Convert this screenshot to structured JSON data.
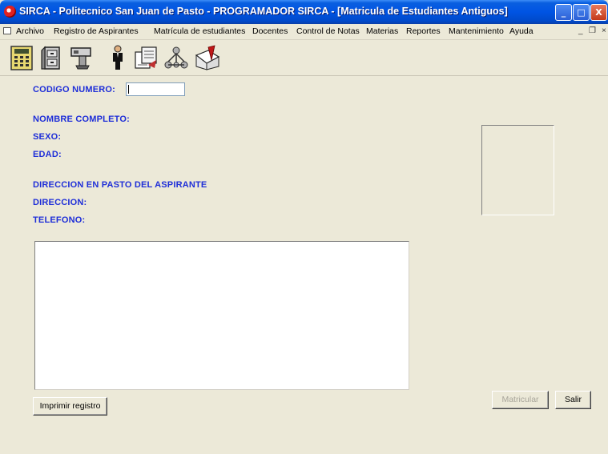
{
  "window": {
    "title": "SIRCA - Politecnico San Juan de Pasto - PROGRAMADOR SIRCA - [Matricula de Estudiantes Antiguos]",
    "controls": {
      "minimize": "_",
      "maximize": "□",
      "close": "X"
    }
  },
  "menu": {
    "items": [
      "Archivo",
      "Registro de Aspirantes",
      "Matrícula de estudiantes",
      "Docentes",
      "Control de Notas",
      "Materias",
      "Reportes",
      "Mantenimiento",
      "Ayuda"
    ],
    "mdi_controls": {
      "minimize": "_",
      "restore": "❐",
      "close": "×"
    }
  },
  "toolbar": {
    "icons": [
      "calculator-icon",
      "file-cabinet-icon",
      "projector-icon",
      "person-icon",
      "documents-icon",
      "network-icon",
      "edit-document-icon"
    ]
  },
  "form": {
    "codigo_label": "CODIGO NUMERO:",
    "codigo_value": "",
    "nombre_label": "NOMBRE COMPLETO:",
    "sexo_label": "SEXO:",
    "edad_label": "EDAD:",
    "direccion_section_label": "DIRECCION EN PASTO DEL ASPIRANTE",
    "direccion_label": "DIRECCION:",
    "telefono_label": "TELEFONO:"
  },
  "buttons": {
    "imprimir": "Imprimir registro",
    "matricular": "Matricular",
    "salir": "Salir"
  },
  "colors": {
    "label_blue": "#1e2ed8",
    "titlebar_blue": "#0054e3",
    "window_bg": "#ece9d8"
  }
}
